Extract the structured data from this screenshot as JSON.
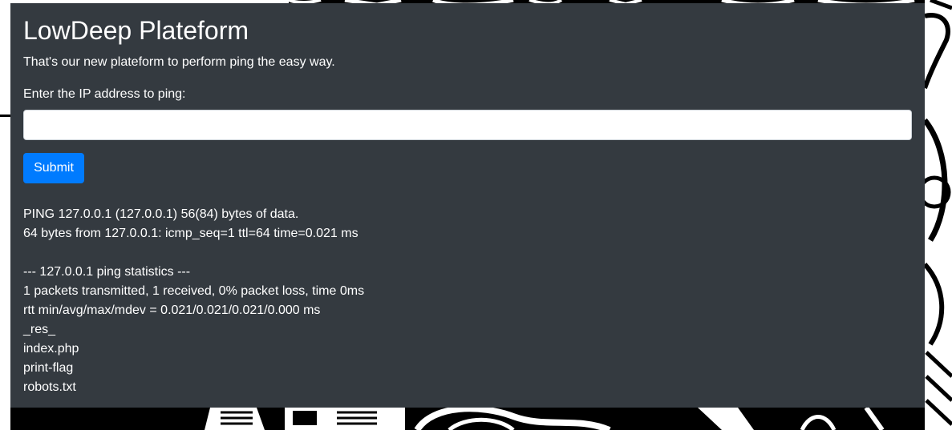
{
  "page": {
    "title": "LowDeep Plateform",
    "subtitle": "That's our new plateform to perform ping the easy way."
  },
  "form": {
    "label": "Enter the IP address to ping:",
    "input_value": "",
    "input_placeholder": "",
    "submit_label": "Submit"
  },
  "output": {
    "lines": [
      "PING 127.0.0.1 (127.0.0.1) 56(84) bytes of data.",
      "64 bytes from 127.0.0.1: icmp_seq=1 ttl=64 time=0.021 ms",
      "",
      "--- 127.0.0.1 ping statistics ---",
      "1 packets transmitted, 1 received, 0% packet loss, time 0ms",
      "rtt min/avg/max/mdev = 0.021/0.021/0.021/0.000 ms",
      "_res_",
      "index.php",
      "print-flag",
      "robots.txt"
    ]
  },
  "colors": {
    "panel_background": "#343a40",
    "button_primary": "#007bff",
    "text": "#ffffff"
  }
}
